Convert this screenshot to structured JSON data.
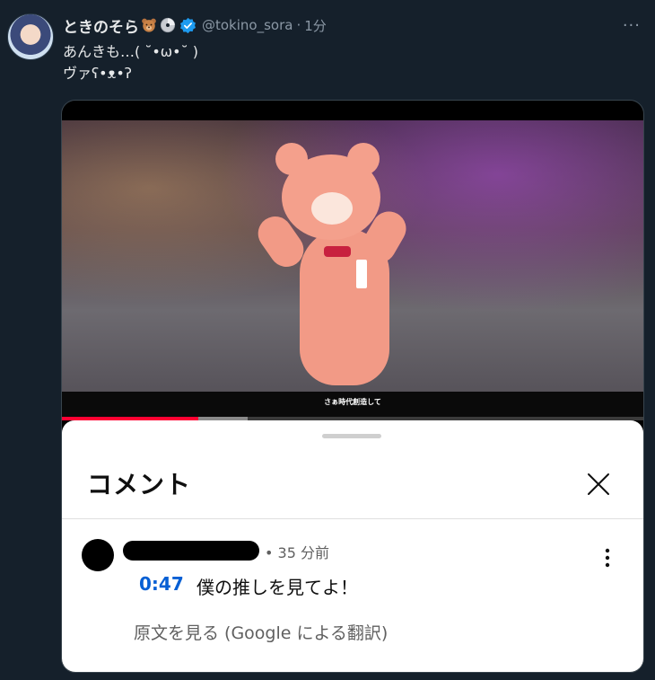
{
  "tweet": {
    "display_name": "ときのそら",
    "handle": "@tokino_sora",
    "separator": "·",
    "time_ago": "1分",
    "text_line1": "あんきも…( ˘•ω•˘ )",
    "text_line2": "ヴァʕ•ᴥ•ʔ",
    "more_label": "···"
  },
  "video": {
    "subtitle": "さぁ時代創造して",
    "progress_played": 0.235,
    "progress_buffered": 0.32
  },
  "comments": {
    "title": "コメント",
    "comment": {
      "meta": "• 35 分前",
      "timestamp": "0:47",
      "text": "僕の推しを見てよ！",
      "translate": "原文を見る (Google による翻訳)"
    }
  },
  "colors": {
    "background": "#15202b",
    "verified": "#1d9bf0",
    "progress": "#ff0033",
    "timestamp_link": "#065fd4"
  }
}
